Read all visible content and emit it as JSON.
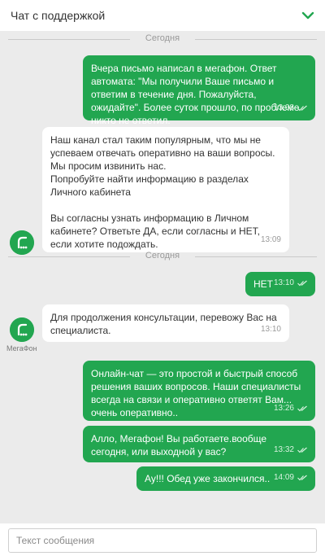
{
  "header": {
    "title": "Чат с поддержкой"
  },
  "date_separators": [
    "Сегодня",
    "Сегодня"
  ],
  "messages": [
    {
      "direction": "out",
      "text": "Вчера письмо написал в мегафон. Ответ автомата: \"Мы получили Ваше письмо и ответим в течение дня. Пожалуйста, ожидайте\". Более суток прошло, по проблеме никто не ответил.",
      "time": "13:08"
    },
    {
      "direction": "in",
      "text": "Наш канал стал таким популярным, что мы не успеваем отвечать оперативно на ваши вопросы. Мы просим извинить нас.\nПопробуйте найти информацию в разделах Личного кабинета\n\nВы согласны узнать информацию в Личном кабинете? Ответьте ДА, если согласны и НЕТ, если хотите подождать.",
      "time": "13:09"
    },
    {
      "direction": "out",
      "text": "НЕТ",
      "time": "13:10"
    },
    {
      "direction": "in",
      "text": "Для продолжения консультации, перевожу Вас на специалиста.",
      "time": "13:10",
      "avatar_caption": "МегаФон"
    },
    {
      "direction": "out",
      "text": "Онлайн-чат — это простой и быстрый способ решения ваших вопросов. Наши специалисты всегда на связи и оперативно ответят Вам... очень оперативно..",
      "time": "13:26"
    },
    {
      "direction": "out",
      "text": "Алло, Мегафон! Вы работаете.вообще сегодня, или выходной у вас?",
      "time": "13:32"
    },
    {
      "direction": "out",
      "text": "Ау!!! Обед уже закончился..",
      "time": "14:09"
    }
  ],
  "composer": {
    "placeholder": "Текст сообщения"
  },
  "colors": {
    "accent": "#22a650",
    "background": "#ebebeb"
  },
  "icons": [
    "chevron-down-icon",
    "megafon-logo-icon",
    "double-check-icon"
  ]
}
